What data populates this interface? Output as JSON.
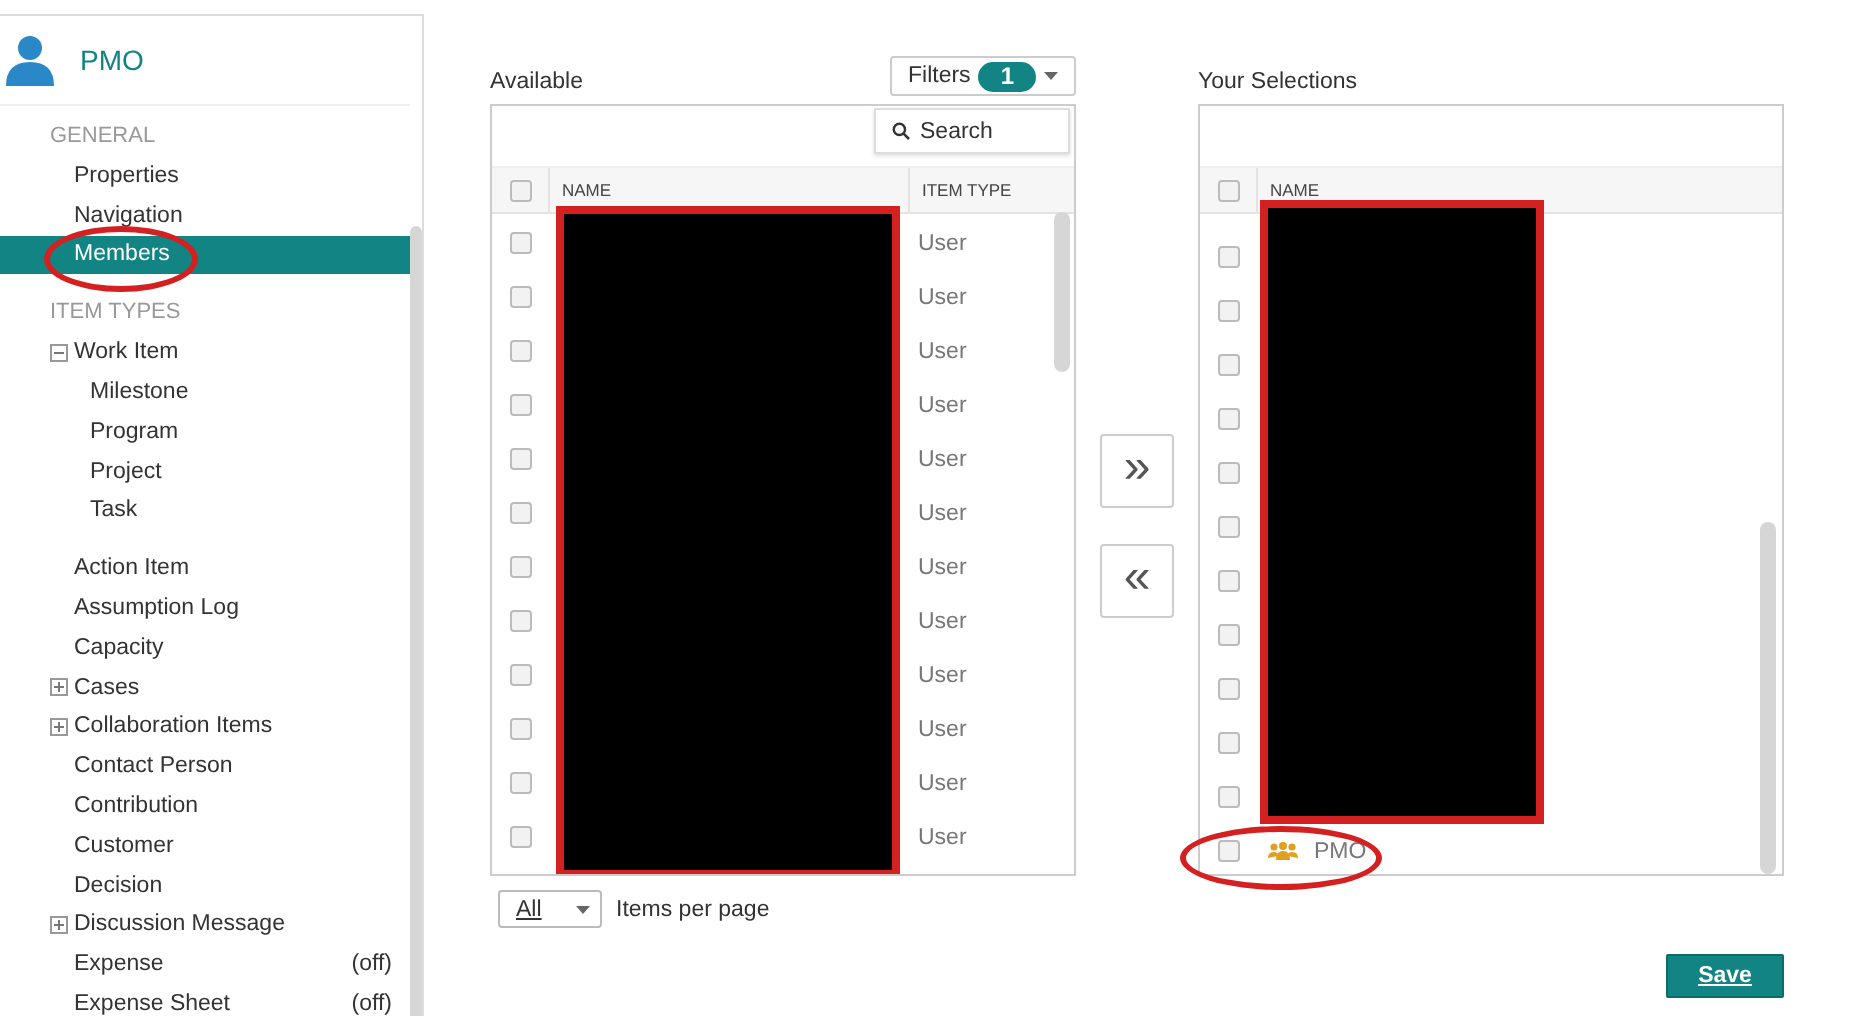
{
  "sidebar": {
    "title": "PMO",
    "sections": [
      {
        "heading": "GENERAL",
        "items": [
          {
            "label": "Properties",
            "selected": false
          },
          {
            "label": "Navigation",
            "selected": false
          },
          {
            "label": "Members",
            "selected": true
          }
        ]
      },
      {
        "heading": "ITEM TYPES",
        "items": [
          {
            "label": "Work Item",
            "selected": false,
            "expanded": true,
            "children": [
              {
                "label": "Milestone",
                "selected": false
              },
              {
                "label": "Program",
                "selected": false
              },
              {
                "label": "Project",
                "selected": false
              },
              {
                "label": "Task",
                "selected": false
              }
            ]
          },
          {
            "label": "Action Item",
            "selected": false
          },
          {
            "label": "Assumption Log",
            "selected": false
          },
          {
            "label": "Capacity",
            "selected": false
          },
          {
            "label": "Cases",
            "selected": false,
            "expanded": false
          },
          {
            "label": "Collaboration Items",
            "selected": false,
            "expanded": false
          },
          {
            "label": "Contact Person",
            "selected": false
          },
          {
            "label": "Contribution",
            "selected": false
          },
          {
            "label": "Customer",
            "selected": false
          },
          {
            "label": "Decision",
            "selected": false
          },
          {
            "label": "Discussion Message",
            "selected": false,
            "expanded": false
          },
          {
            "label": "Expense",
            "selected": false,
            "status": "(off)"
          },
          {
            "label": "Expense Sheet",
            "selected": false,
            "status": "(off)"
          }
        ]
      }
    ]
  },
  "available": {
    "title": "Available",
    "filters": {
      "label": "Filters",
      "count": "1"
    },
    "search": {
      "placeholder": "Search"
    },
    "select_all": {
      "checked": false
    },
    "columns": [
      "NAME",
      "ITEM TYPE"
    ],
    "rows": [
      {
        "item_type": "User",
        "checked": false
      },
      {
        "item_type": "User",
        "checked": false
      },
      {
        "item_type": "User",
        "checked": false
      },
      {
        "item_type": "User",
        "checked": false
      },
      {
        "item_type": "User",
        "checked": false
      },
      {
        "item_type": "User",
        "checked": false
      },
      {
        "item_type": "User",
        "checked": false
      },
      {
        "item_type": "User",
        "checked": false
      },
      {
        "item_type": "User",
        "checked": false
      },
      {
        "item_type": "User",
        "checked": false
      },
      {
        "item_type": "User",
        "checked": false
      },
      {
        "item_type": "User",
        "checked": false
      }
    ],
    "page_size": "All",
    "page_size_label": "Items per page"
  },
  "transfer_buttons": [
    "»",
    "«"
  ],
  "selections": {
    "title": "Your Selections",
    "select_all": {
      "checked": false
    },
    "columns": [
      "NAME"
    ],
    "rows": [
      {
        "kind": "hidden",
        "checked": false
      },
      {
        "kind": "hidden",
        "checked": false
      },
      {
        "kind": "hidden",
        "checked": false
      },
      {
        "kind": "hidden",
        "checked": false
      },
      {
        "kind": "hidden",
        "checked": false
      },
      {
        "kind": "hidden",
        "checked": false
      },
      {
        "kind": "hidden",
        "checked": false
      },
      {
        "kind": "hidden",
        "checked": false
      },
      {
        "kind": "hidden",
        "checked": false
      },
      {
        "kind": "hidden",
        "checked": false
      },
      {
        "kind": "hidden",
        "checked": false
      },
      {
        "kind": "group",
        "name": "PMO",
        "checked": false
      }
    ]
  },
  "save_button": "Save"
}
